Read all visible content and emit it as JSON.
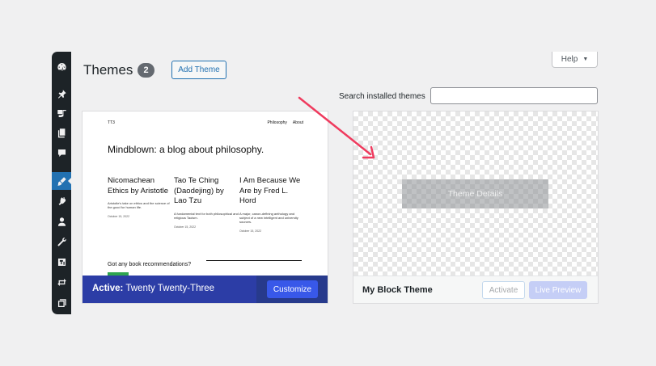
{
  "header": {
    "title": "Themes",
    "count": "2",
    "add_theme_label": "Add Theme",
    "help_label": "Help"
  },
  "search": {
    "label": "Search installed themes",
    "value": "",
    "placeholder": ""
  },
  "sidebar": {
    "items": [
      {
        "icon": "dashboard-icon"
      },
      {
        "icon": "pin-icon"
      },
      {
        "icon": "media-icon"
      },
      {
        "icon": "pages-icon"
      },
      {
        "icon": "comments-icon"
      },
      {
        "icon": "appearance-icon",
        "active": true
      },
      {
        "icon": "plugins-icon"
      },
      {
        "icon": "users-icon"
      },
      {
        "icon": "tools-icon"
      },
      {
        "icon": "settings-icon"
      },
      {
        "icon": "sync-icon"
      },
      {
        "icon": "collapse-icon"
      }
    ]
  },
  "active_theme": {
    "preview": {
      "site_logo": "TT3",
      "nav": [
        "Philosophy",
        "About"
      ],
      "headline": "Mindblown: a blog about philosophy.",
      "posts": [
        {
          "title": "Nicomachean Ethics by Aristotle",
          "excerpt": "Aristotle's take on ethics and the science of the good for human life.",
          "date": "October 15, 2022"
        },
        {
          "title": "Tao Te Ching (Daodejing) by Lao Tzu",
          "excerpt": "A fundamental text for both philosophical and religious Taoism.",
          "date": "October 15, 2022"
        },
        {
          "title": "I Am Because We Are by Fred L. Hord",
          "excerpt": "A major, canon-defining anthology and subject of a new intelligent and university sources.",
          "date": "October 15, 2022"
        }
      ],
      "recommendation_text": "Got any book recommendations?"
    },
    "active_prefix": "Active:",
    "name": "Twenty Twenty-Three",
    "customize_label": "Customize"
  },
  "theme_card": {
    "overlay_label": "Theme Details",
    "name": "My Block Theme",
    "activate_label": "Activate",
    "live_preview_label": "Live Preview"
  },
  "colors": {
    "sidebar_bg": "#1d2327",
    "accent": "#2271b1",
    "active_bar": "#2c3da6",
    "customize_button": "#3858e9",
    "arrow": "#ef3b5e"
  }
}
